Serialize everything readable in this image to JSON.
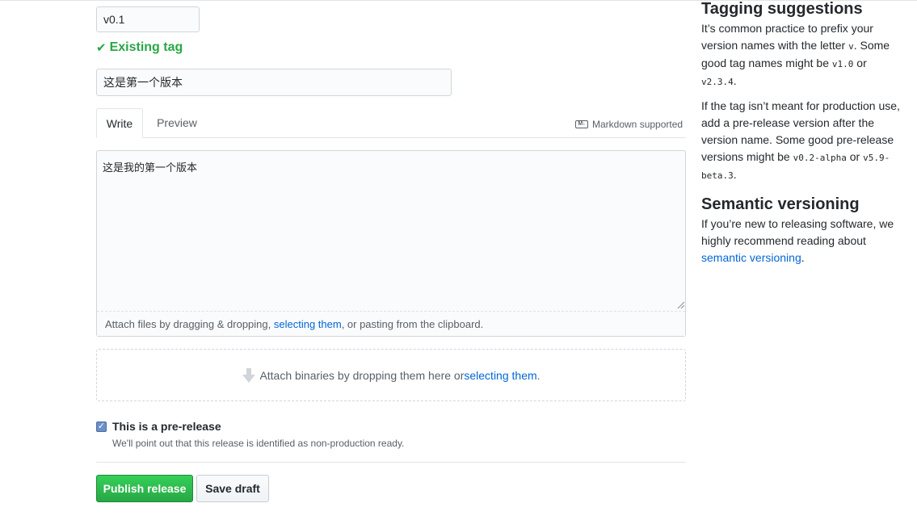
{
  "release_form": {
    "tag_value": "v0.1",
    "tag_status": "Existing tag",
    "title_value": "这是第一个版本",
    "tabs": [
      {
        "label": "Write",
        "active": true
      },
      {
        "label": "Preview",
        "active": false
      }
    ],
    "markdown_supported": "Markdown supported",
    "body_value": "这是我的第一个版本",
    "attach_files": {
      "prefix": "Attach files by dragging & dropping, ",
      "link": "selecting them",
      "suffix": ", or pasting from the clipboard."
    },
    "attach_binaries": {
      "prefix": "Attach binaries by dropping them here or ",
      "link": "selecting them",
      "suffix": "."
    },
    "prerelease": {
      "checked": true,
      "label": "This is a pre-release",
      "note": "We'll point out that this release is identified as non-production ready."
    },
    "buttons": {
      "publish": "Publish release",
      "save_draft": "Save draft"
    }
  },
  "sidebar": {
    "tagging": {
      "heading": "Tagging suggestions",
      "p1_text1": "It’s common practice to prefix your version names with the letter ",
      "p1_code1": "v",
      "p1_text2": ". Some good tag names might be ",
      "p1_code2": "v1.0",
      "p1_text3": " or ",
      "p1_code3": "v2.3.4",
      "p1_text4": ".",
      "p2_text1": "If the tag isn’t meant for production use, add a pre-release version after the version name. Some good pre-release versions might be ",
      "p2_code1": "v0.2-alpha",
      "p2_text2": " or ",
      "p2_code2": "v5.9-beta.3",
      "p2_text3": "."
    },
    "semver": {
      "heading": "Semantic versioning",
      "text1": "If you’re new to releasing software, we highly recommend reading about ",
      "link": "semantic versioning",
      "text2": "."
    }
  },
  "colors": {
    "success_green": "#28a745",
    "link_blue": "#0366d6",
    "border_gray": "#d1d5da"
  }
}
